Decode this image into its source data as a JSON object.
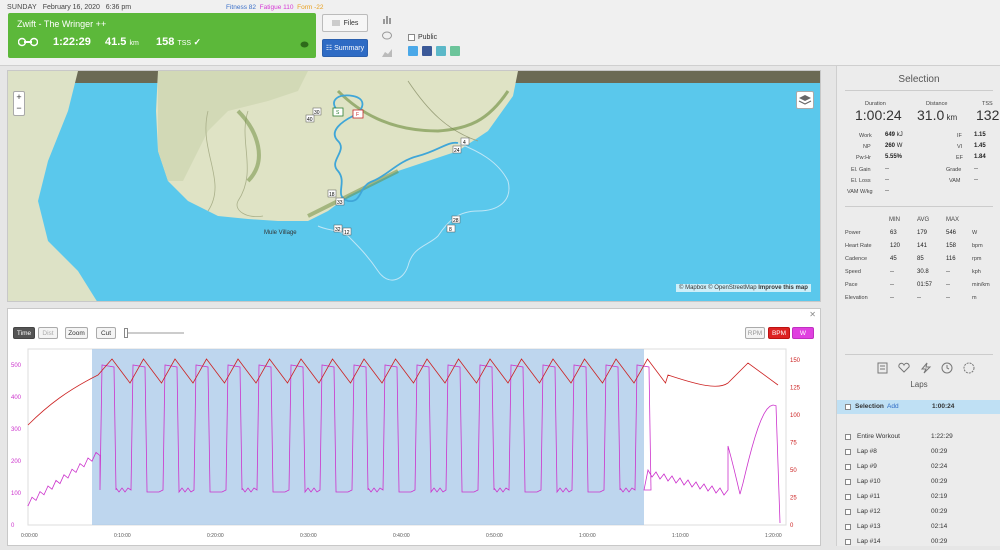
{
  "header": {
    "day": "SUNDAY",
    "date": "February 16, 2020",
    "time": "6:36 pm",
    "fitness": "Fitness 82",
    "fatigue": "Fatigue 110",
    "form": "Form -22",
    "workout_title": "Zwift - The Wringer ++",
    "duration": "1:22:29",
    "distance": "41.5",
    "distance_unit": "km",
    "tss": "158",
    "tss_unit": "TSS",
    "files_label": "Files",
    "summary_label": "Summary",
    "public_label": "Public"
  },
  "map": {
    "attribution": "© Mapbox © OpenStreetMap",
    "improve": "Improve this map",
    "village": "Mule Village",
    "zoom_in": "+",
    "zoom_out": "−",
    "markers": [
      "30",
      "40",
      "S",
      "F",
      "18",
      "33",
      "32",
      "12",
      "28",
      "8",
      "4",
      "24"
    ]
  },
  "chart": {
    "toolbar": {
      "time": "Time",
      "dist": "Dist",
      "zoom": "Zoom",
      "cut": "Cut"
    },
    "legend": {
      "rpm": "RPM",
      "bpm": "BPM",
      "w": "W"
    },
    "left_ticks": [
      "500",
      "400",
      "300",
      "200",
      "100",
      "0"
    ],
    "right_ticks": [
      "150",
      "125",
      "100",
      "75",
      "50",
      "25",
      "0"
    ],
    "x_ticks": [
      "0:00:00",
      "0:10:00",
      "0:20:00",
      "0:30:00",
      "0:40:00",
      "0:50:00",
      "1:00:00",
      "1:10:00",
      "1:20:00"
    ],
    "colors": {
      "power": "#cc33cc",
      "hr": "#cc2222",
      "selection": "#a8c8e8"
    }
  },
  "selection": {
    "title": "Selection",
    "duration_label": "Duration",
    "duration": "1:00:24",
    "distance_label": "Distance",
    "distance": "31.0",
    "distance_unit": "km",
    "tss_label": "TSS",
    "tss": "132",
    "work_label": "Work",
    "work": "649",
    "work_unit": "kJ",
    "np_label": "NP",
    "np": "260",
    "np_unit": "W",
    "pwhr_label": "Pw:Hr",
    "pwhr": "5.55%",
    "if_label": "IF",
    "if": "1.15",
    "vi_label": "VI",
    "vi": "1.45",
    "ef_label": "EF",
    "ef": "1.84",
    "elgain_label": "El. Gain",
    "elgain": "--",
    "elloss_label": "El. Loss",
    "elloss": "--",
    "vam_wkg_label": "VAM W/kg",
    "vam_wkg": "--",
    "grade_label": "Grade",
    "grade": "--",
    "vam_label": "VAM",
    "vam": "--",
    "table_headers": [
      "MIN",
      "AVG",
      "MAX"
    ],
    "rows": [
      {
        "label": "Power",
        "min": "63",
        "avg": "179",
        "max": "546",
        "unit": "W"
      },
      {
        "label": "Heart Rate",
        "min": "120",
        "avg": "141",
        "max": "158",
        "unit": "bpm"
      },
      {
        "label": "Cadence",
        "min": "45",
        "avg": "85",
        "max": "116",
        "unit": "rpm"
      },
      {
        "label": "Speed",
        "min": "--",
        "avg": "30.8",
        "max": "--",
        "unit": "kph"
      },
      {
        "label": "Pace",
        "min": "--",
        "avg": "01:57",
        "max": "--",
        "unit": "min/km"
      },
      {
        "label": "Elevation",
        "min": "--",
        "avg": "--",
        "max": "--",
        "unit": "m"
      }
    ]
  },
  "laps": {
    "title": "Laps",
    "selection_name": "Selection",
    "add_label": "Add",
    "selection_time": "1:00:24",
    "items": [
      {
        "name": "Entire Workout",
        "time": "1:22:29"
      },
      {
        "name": "Lap #8",
        "time": "00:29"
      },
      {
        "name": "Lap #9",
        "time": "02:24"
      },
      {
        "name": "Lap #10",
        "time": "00:29"
      },
      {
        "name": "Lap #11",
        "time": "02:19"
      },
      {
        "name": "Lap #12",
        "time": "00:29"
      },
      {
        "name": "Lap #13",
        "time": "02:14"
      },
      {
        "name": "Lap #14",
        "time": "00:29"
      }
    ]
  }
}
